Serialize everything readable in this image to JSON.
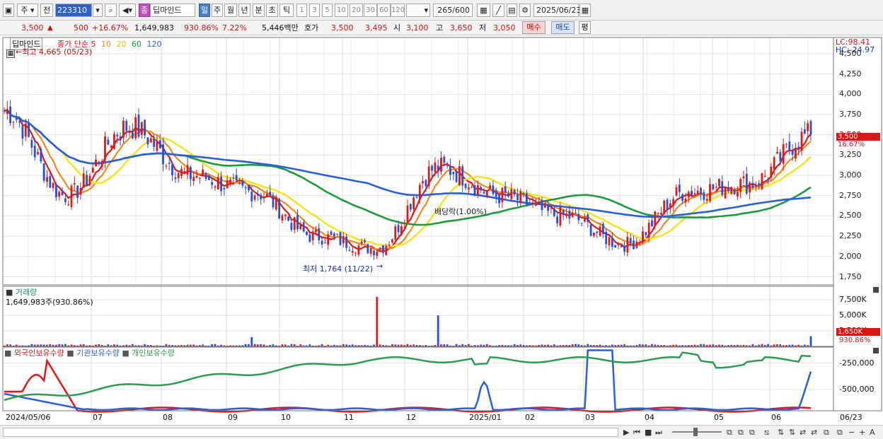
{
  "toolbar": {
    "period_main": "주",
    "period_alt": "전",
    "code": "223310",
    "stock_name": "딥마인드",
    "stock_badge": "종",
    "intervals": [
      "일",
      "주",
      "월",
      "년",
      "분",
      "초",
      "틱"
    ],
    "active_interval": "일",
    "numbers": [
      "1",
      "3",
      "5",
      "10",
      "20",
      "30",
      "60",
      "120"
    ],
    "count": "265",
    "count_total": "/600",
    "date": "2025/06/23"
  },
  "quote": {
    "price": "3,500",
    "change": "500",
    "change_pct": "+16.67%",
    "volume": "1,649,983",
    "volume_ratio": "930.86%",
    "turnover_ratio": "7.22%",
    "amount": "5,446백만",
    "ask_label": "호가",
    "ask": "3,500",
    "bid": "3,495",
    "open_label": "시",
    "open": "3,100",
    "high_label": "고",
    "high": "3,650",
    "low_label": "저",
    "low": "3,050",
    "buy_button": "매수",
    "sell_button": "매도",
    "eval_button": "평"
  },
  "price_panel": {
    "title": "딥마인드",
    "ma_label": "종가 단순",
    "ma_periods": [
      "5",
      "10",
      "20",
      "60",
      "120"
    ],
    "ma_colors": [
      "#e01818",
      "#f08a18",
      "#f2e62a",
      "#1e9a3c",
      "#2a5ee0"
    ],
    "high_note": "←최고 4,665 (05/23)",
    "low_note": "최저 1,764 (11/22)",
    "dividend_note": "배당락(1.00%)",
    "lc": "LC:98.41",
    "hc": "HC:-24.97",
    "current_tag": "3,500",
    "current_pct": "16.67%",
    "y_ticks": [
      "4,500",
      "4,250",
      "4,000",
      "3,750",
      "3,500",
      "3,250",
      "3,000",
      "2,750",
      "2,500",
      "2,250",
      "2,000",
      "1,750"
    ]
  },
  "volume_panel": {
    "title": "거래량",
    "current": "1,649,983주(930.86%)",
    "y_ticks": [
      "7,500K",
      "5,000K",
      "2,500K"
    ],
    "current_tag": "1,650K",
    "current_pct": "930.86%"
  },
  "holder_panel": {
    "legend": [
      "외국인보유수량",
      "기관보유수량",
      "개인보유수량"
    ],
    "colors": [
      "#e01818",
      "#2a5ee0",
      "#2e9a52"
    ],
    "y_ticks": [
      "-250,000",
      "-500,000"
    ]
  },
  "x_axis": [
    "2024/05/06",
    "07",
    "08",
    "09",
    "10",
    "11",
    "12",
    "2025/01",
    "02",
    "03",
    "04",
    "05",
    "06",
    "06/23"
  ],
  "chart_data": [
    {
      "type": "candlestick",
      "title": "딥마인드",
      "x": [
        "2024/05/06",
        "2024/07",
        "2024/08",
        "2024/09",
        "2024/10",
        "2024/11",
        "2024/12",
        "2025/01",
        "2025/02",
        "2025/03",
        "2025/04",
        "2025/05",
        "2025/06",
        "2025/06/23"
      ],
      "close": [
        3800,
        2750,
        3600,
        3000,
        2800,
        2250,
        2100,
        3100,
        2750,
        2500,
        2150,
        2800,
        2900,
        3500
      ],
      "ylim": [
        1650,
        4700
      ],
      "high_marker": {
        "value": 4665,
        "date": "05/23"
      },
      "low_marker": {
        "value": 1764,
        "date": "11/22"
      }
    },
    {
      "type": "bar",
      "title": "거래량",
      "last_value": 1649983,
      "ylim": [
        0,
        9000000
      ],
      "spikes": [
        {
          "x": "2024/10",
          "value": 1500000
        },
        {
          "x": "2024/12",
          "value": 8000000
        },
        {
          "x": "2025/01",
          "value": 5000000
        },
        {
          "x": "2025/06/23",
          "value": 1650000
        }
      ]
    },
    {
      "type": "line",
      "series": [
        {
          "name": "외국인보유수량"
        },
        {
          "name": "기관보유수량"
        },
        {
          "name": "개인보유수량"
        }
      ],
      "ylim": [
        -700000,
        -100000
      ]
    }
  ]
}
